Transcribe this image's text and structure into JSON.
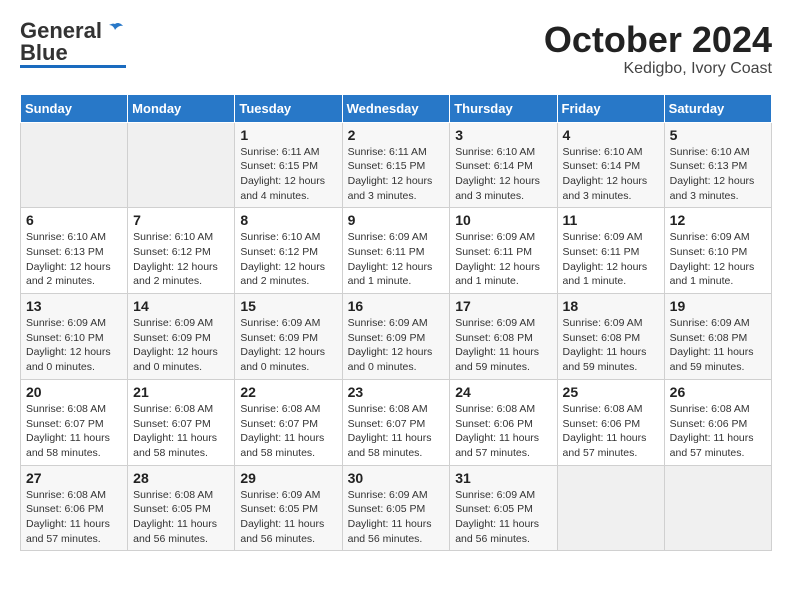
{
  "header": {
    "logo_general": "General",
    "logo_blue": "Blue",
    "month": "October 2024",
    "location": "Kedigbo, Ivory Coast"
  },
  "days_of_week": [
    "Sunday",
    "Monday",
    "Tuesday",
    "Wednesday",
    "Thursday",
    "Friday",
    "Saturday"
  ],
  "weeks": [
    [
      {
        "day": "",
        "info": ""
      },
      {
        "day": "",
        "info": ""
      },
      {
        "day": "1",
        "info": "Sunrise: 6:11 AM\nSunset: 6:15 PM\nDaylight: 12 hours\nand 4 minutes."
      },
      {
        "day": "2",
        "info": "Sunrise: 6:11 AM\nSunset: 6:15 PM\nDaylight: 12 hours\nand 3 minutes."
      },
      {
        "day": "3",
        "info": "Sunrise: 6:10 AM\nSunset: 6:14 PM\nDaylight: 12 hours\nand 3 minutes."
      },
      {
        "day": "4",
        "info": "Sunrise: 6:10 AM\nSunset: 6:14 PM\nDaylight: 12 hours\nand 3 minutes."
      },
      {
        "day": "5",
        "info": "Sunrise: 6:10 AM\nSunset: 6:13 PM\nDaylight: 12 hours\nand 3 minutes."
      }
    ],
    [
      {
        "day": "6",
        "info": "Sunrise: 6:10 AM\nSunset: 6:13 PM\nDaylight: 12 hours\nand 2 minutes."
      },
      {
        "day": "7",
        "info": "Sunrise: 6:10 AM\nSunset: 6:12 PM\nDaylight: 12 hours\nand 2 minutes."
      },
      {
        "day": "8",
        "info": "Sunrise: 6:10 AM\nSunset: 6:12 PM\nDaylight: 12 hours\nand 2 minutes."
      },
      {
        "day": "9",
        "info": "Sunrise: 6:09 AM\nSunset: 6:11 PM\nDaylight: 12 hours\nand 1 minute."
      },
      {
        "day": "10",
        "info": "Sunrise: 6:09 AM\nSunset: 6:11 PM\nDaylight: 12 hours\nand 1 minute."
      },
      {
        "day": "11",
        "info": "Sunrise: 6:09 AM\nSunset: 6:11 PM\nDaylight: 12 hours\nand 1 minute."
      },
      {
        "day": "12",
        "info": "Sunrise: 6:09 AM\nSunset: 6:10 PM\nDaylight: 12 hours\nand 1 minute."
      }
    ],
    [
      {
        "day": "13",
        "info": "Sunrise: 6:09 AM\nSunset: 6:10 PM\nDaylight: 12 hours\nand 0 minutes."
      },
      {
        "day": "14",
        "info": "Sunrise: 6:09 AM\nSunset: 6:09 PM\nDaylight: 12 hours\nand 0 minutes."
      },
      {
        "day": "15",
        "info": "Sunrise: 6:09 AM\nSunset: 6:09 PM\nDaylight: 12 hours\nand 0 minutes."
      },
      {
        "day": "16",
        "info": "Sunrise: 6:09 AM\nSunset: 6:09 PM\nDaylight: 12 hours\nand 0 minutes."
      },
      {
        "day": "17",
        "info": "Sunrise: 6:09 AM\nSunset: 6:08 PM\nDaylight: 11 hours\nand 59 minutes."
      },
      {
        "day": "18",
        "info": "Sunrise: 6:09 AM\nSunset: 6:08 PM\nDaylight: 11 hours\nand 59 minutes."
      },
      {
        "day": "19",
        "info": "Sunrise: 6:09 AM\nSunset: 6:08 PM\nDaylight: 11 hours\nand 59 minutes."
      }
    ],
    [
      {
        "day": "20",
        "info": "Sunrise: 6:08 AM\nSunset: 6:07 PM\nDaylight: 11 hours\nand 58 minutes."
      },
      {
        "day": "21",
        "info": "Sunrise: 6:08 AM\nSunset: 6:07 PM\nDaylight: 11 hours\nand 58 minutes."
      },
      {
        "day": "22",
        "info": "Sunrise: 6:08 AM\nSunset: 6:07 PM\nDaylight: 11 hours\nand 58 minutes."
      },
      {
        "day": "23",
        "info": "Sunrise: 6:08 AM\nSunset: 6:07 PM\nDaylight: 11 hours\nand 58 minutes."
      },
      {
        "day": "24",
        "info": "Sunrise: 6:08 AM\nSunset: 6:06 PM\nDaylight: 11 hours\nand 57 minutes."
      },
      {
        "day": "25",
        "info": "Sunrise: 6:08 AM\nSunset: 6:06 PM\nDaylight: 11 hours\nand 57 minutes."
      },
      {
        "day": "26",
        "info": "Sunrise: 6:08 AM\nSunset: 6:06 PM\nDaylight: 11 hours\nand 57 minutes."
      }
    ],
    [
      {
        "day": "27",
        "info": "Sunrise: 6:08 AM\nSunset: 6:06 PM\nDaylight: 11 hours\nand 57 minutes."
      },
      {
        "day": "28",
        "info": "Sunrise: 6:08 AM\nSunset: 6:05 PM\nDaylight: 11 hours\nand 56 minutes."
      },
      {
        "day": "29",
        "info": "Sunrise: 6:09 AM\nSunset: 6:05 PM\nDaylight: 11 hours\nand 56 minutes."
      },
      {
        "day": "30",
        "info": "Sunrise: 6:09 AM\nSunset: 6:05 PM\nDaylight: 11 hours\nand 56 minutes."
      },
      {
        "day": "31",
        "info": "Sunrise: 6:09 AM\nSunset: 6:05 PM\nDaylight: 11 hours\nand 56 minutes."
      },
      {
        "day": "",
        "info": ""
      },
      {
        "day": "",
        "info": ""
      }
    ]
  ]
}
